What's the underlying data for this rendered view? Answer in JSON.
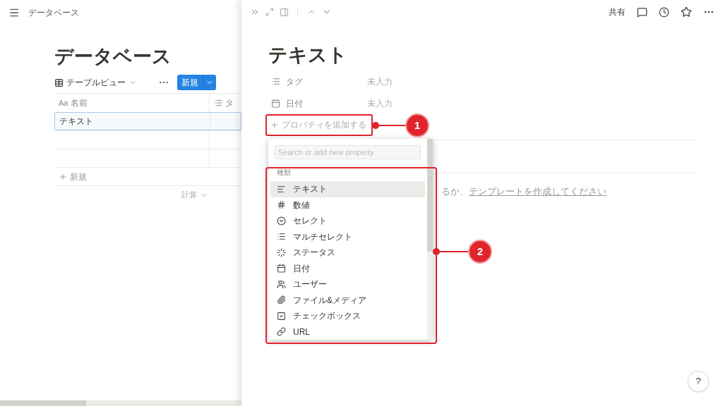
{
  "left": {
    "breadcrumb": "データベース",
    "title": "データベース",
    "view": "テーブルビュー",
    "new_button": "新規",
    "columns": [
      {
        "prefix": "Aa",
        "label": "名前"
      },
      {
        "label": "タ"
      }
    ],
    "rows": [
      {
        "name": "テキスト",
        "selected": true
      },
      {
        "name": "",
        "selected": false
      },
      {
        "name": "",
        "selected": false
      }
    ],
    "add_row": "新規",
    "calc": "計算"
  },
  "right": {
    "share": "共有",
    "title": "テキスト",
    "properties": [
      {
        "kind": "multi",
        "name": "タグ",
        "value": "未入力"
      },
      {
        "kind": "date",
        "name": "日付",
        "value": "未入力"
      }
    ],
    "add_property": "プロパティを追加する",
    "hint": "るか、",
    "hint_link": "テンプレートを作成してください",
    "help": "?"
  },
  "menu": {
    "placeholder": "Search or add new property",
    "section": "種類",
    "items": [
      {
        "kind": "text",
        "label": "テキスト",
        "selected": true
      },
      {
        "kind": "number",
        "label": "数値",
        "selected": false
      },
      {
        "kind": "select",
        "label": "セレクト",
        "selected": false
      },
      {
        "kind": "multi",
        "label": "マルチセレクト",
        "selected": false
      },
      {
        "kind": "status",
        "label": "ステータス",
        "selected": false
      },
      {
        "kind": "date",
        "label": "日付",
        "selected": false
      },
      {
        "kind": "user",
        "label": "ユーザー",
        "selected": false
      },
      {
        "kind": "file",
        "label": "ファイル&メディア",
        "selected": false
      },
      {
        "kind": "checkbox",
        "label": "チェックボックス",
        "selected": false
      },
      {
        "kind": "url",
        "label": "URL",
        "selected": false
      }
    ]
  },
  "callouts": [
    "1",
    "2"
  ]
}
